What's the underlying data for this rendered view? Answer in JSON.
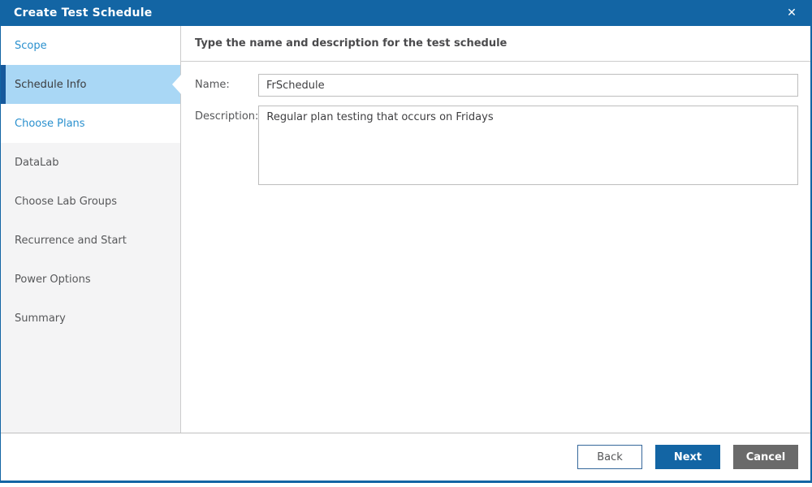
{
  "window": {
    "title": "Create Test Schedule"
  },
  "icons": {
    "close": "✕"
  },
  "colors": {
    "primary_blue": "#1365a4",
    "link_blue": "#2a90ce",
    "selected_bg": "#a9d7f5",
    "selected_strip": "#17599c",
    "sidebar_bg": "#f4f4f5",
    "cancel_gray": "#6a6a6a"
  },
  "sidebar": {
    "steps": [
      {
        "label": "Scope",
        "state": "enabled"
      },
      {
        "label": "Schedule Info",
        "state": "selected"
      },
      {
        "label": "Choose Plans",
        "state": "enabled"
      },
      {
        "label": "DataLab",
        "state": "disabled"
      },
      {
        "label": "Choose Lab Groups",
        "state": "disabled"
      },
      {
        "label": "Recurrence and Start",
        "state": "disabled"
      },
      {
        "label": "Power Options",
        "state": "disabled"
      },
      {
        "label": "Summary",
        "state": "disabled"
      }
    ]
  },
  "content": {
    "header": "Type the name and description for the test schedule",
    "form": {
      "name_label": "Name:",
      "name_value": "FrSchedule",
      "description_label": "Description:",
      "description_value": "Regular plan testing that occurs on Fridays"
    }
  },
  "footer": {
    "back": "Back",
    "next": "Next",
    "cancel": "Cancel"
  }
}
